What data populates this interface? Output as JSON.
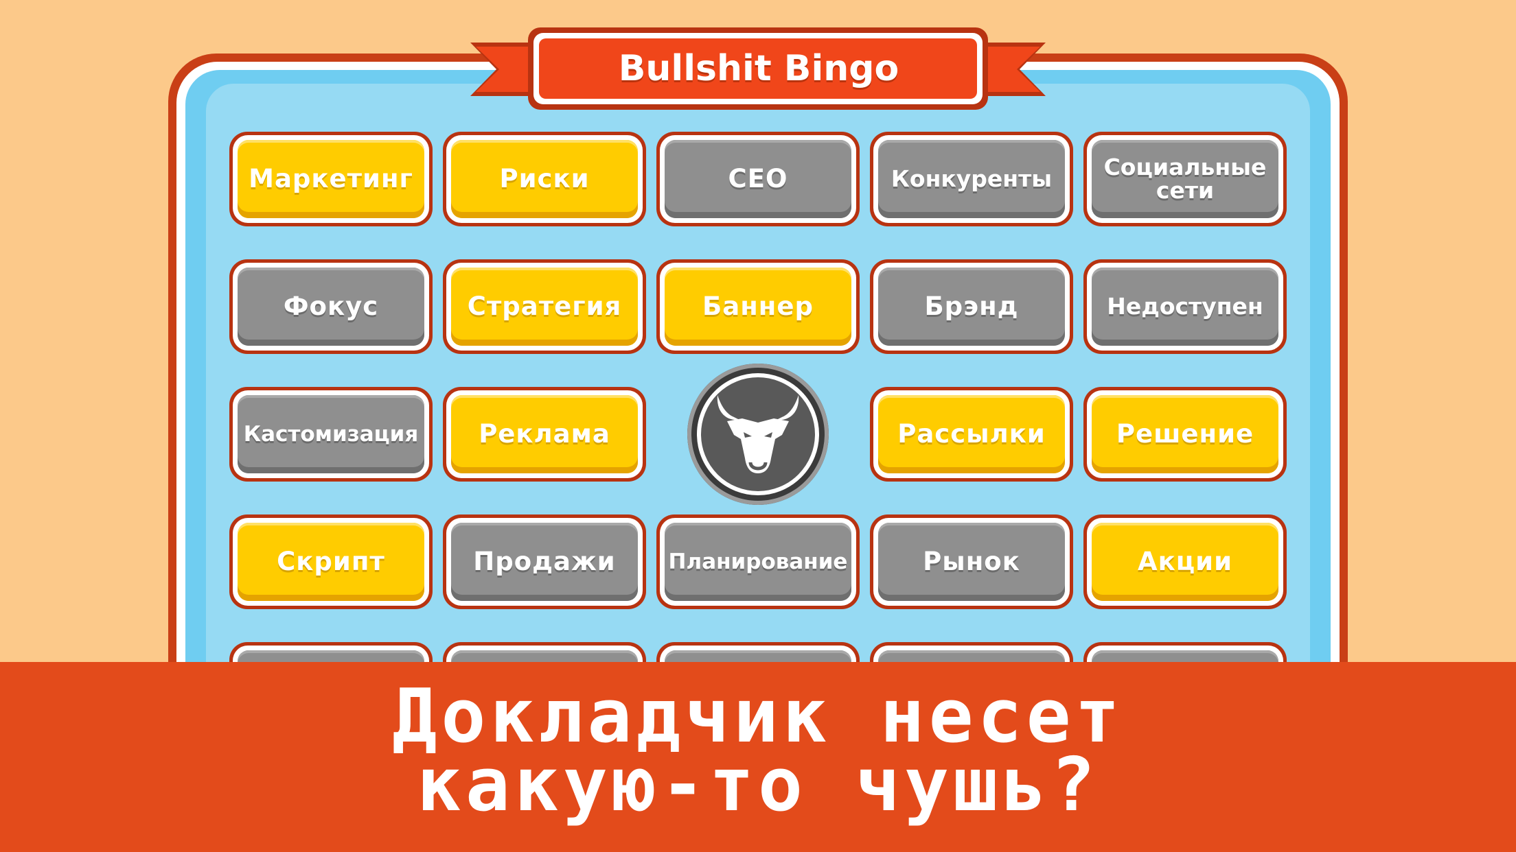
{
  "title": "Bullshit Bingo",
  "grid": {
    "cells": [
      {
        "label": "Маркетинг",
        "state": "yellow"
      },
      {
        "label": "Риски",
        "state": "yellow"
      },
      {
        "label": "CEO",
        "state": "gray"
      },
      {
        "label": "Конкуренты",
        "state": "gray"
      },
      {
        "label": "Социальные сети",
        "state": "gray"
      },
      {
        "label": "Фокус",
        "state": "gray"
      },
      {
        "label": "Стратегия",
        "state": "yellow"
      },
      {
        "label": "Баннер",
        "state": "yellow"
      },
      {
        "label": "Брэнд",
        "state": "gray"
      },
      {
        "label": "Недоступен",
        "state": "gray"
      },
      {
        "label": "Кастомизация",
        "state": "gray"
      },
      {
        "label": "Реклама",
        "state": "yellow"
      },
      {
        "label": "Рассылки",
        "state": "yellow"
      },
      {
        "label": "Решение",
        "state": "yellow"
      },
      {
        "label": "Скрипт",
        "state": "yellow"
      },
      {
        "label": "Продажи",
        "state": "gray"
      },
      {
        "label": "Планирование",
        "state": "gray"
      },
      {
        "label": "Рынок",
        "state": "gray"
      },
      {
        "label": "Акции",
        "state": "yellow"
      }
    ],
    "center_icon": "bull-head-icon"
  },
  "banner": {
    "line1": "Докладчик несет",
    "line2": "какую-то чушь?"
  },
  "colors": {
    "background": "#fcc98a",
    "frame": "#c93f16",
    "board": "#96daf3",
    "marked": "#ffcc00",
    "unmarked": "#8f8f8f",
    "banner": "#e34b1b"
  }
}
